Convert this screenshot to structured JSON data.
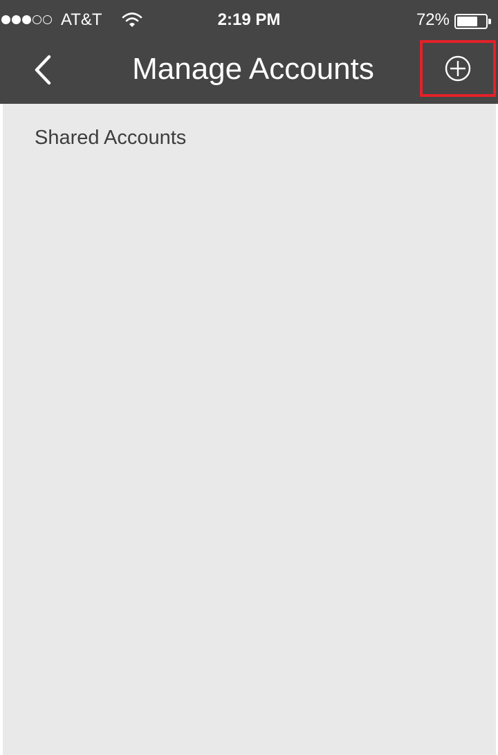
{
  "status_bar": {
    "signal_bars_filled": 3,
    "signal_bars_total": 5,
    "carrier": "AT&T",
    "wifi_icon": "wifi-icon",
    "time": "2:19 PM",
    "battery_percent": "72%",
    "battery_level": 0.72
  },
  "nav_bar": {
    "back_icon": "chevron-left-icon",
    "title": "Manage Accounts",
    "add_icon": "plus-circle-icon",
    "add_highlight_color": "#e32129"
  },
  "content": {
    "section_title": "Shared Accounts"
  },
  "colors": {
    "nav_background": "#454545",
    "content_background": "#e9e9e9",
    "text_primary": "#3d3d3d",
    "highlight": "#e32129"
  }
}
